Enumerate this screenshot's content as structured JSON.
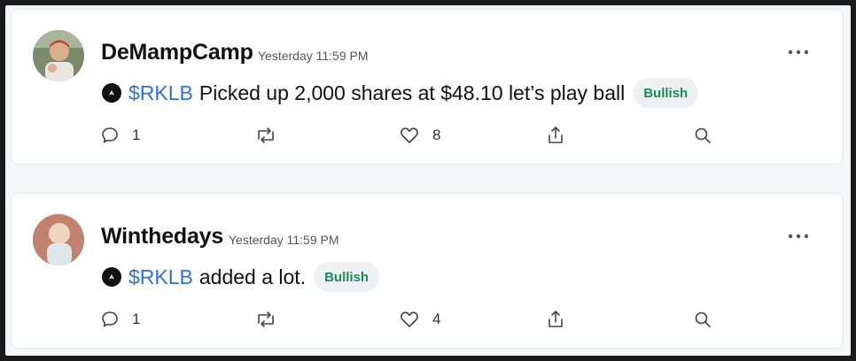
{
  "posts": [
    {
      "username": "DeMampCamp",
      "timestamp": "Yesterday 11:59 PM",
      "cashtag": "$RKLB",
      "text": "Picked up 2,000 shares at $48.10 let’s play ball",
      "sentiment": "Bullish",
      "reply_count": "1",
      "like_count": "8"
    },
    {
      "username": "Winthedays",
      "timestamp": "Yesterday 11:59 PM",
      "cashtag": "$RKLB",
      "text": "added a lot.",
      "sentiment": "Bullish",
      "reply_count": "1",
      "like_count": "4"
    }
  ],
  "icons": {
    "more": "more-horizontal-icon",
    "reply": "comment-icon",
    "repost": "repost-icon",
    "like": "heart-icon",
    "share": "share-icon",
    "search": "search-icon",
    "ticker": "rocket-lab-logo-icon"
  },
  "colors": {
    "cashtag": "#2f6fdd",
    "bullish_text": "#1e8a56",
    "bullish_bg": "#eef1f3"
  }
}
